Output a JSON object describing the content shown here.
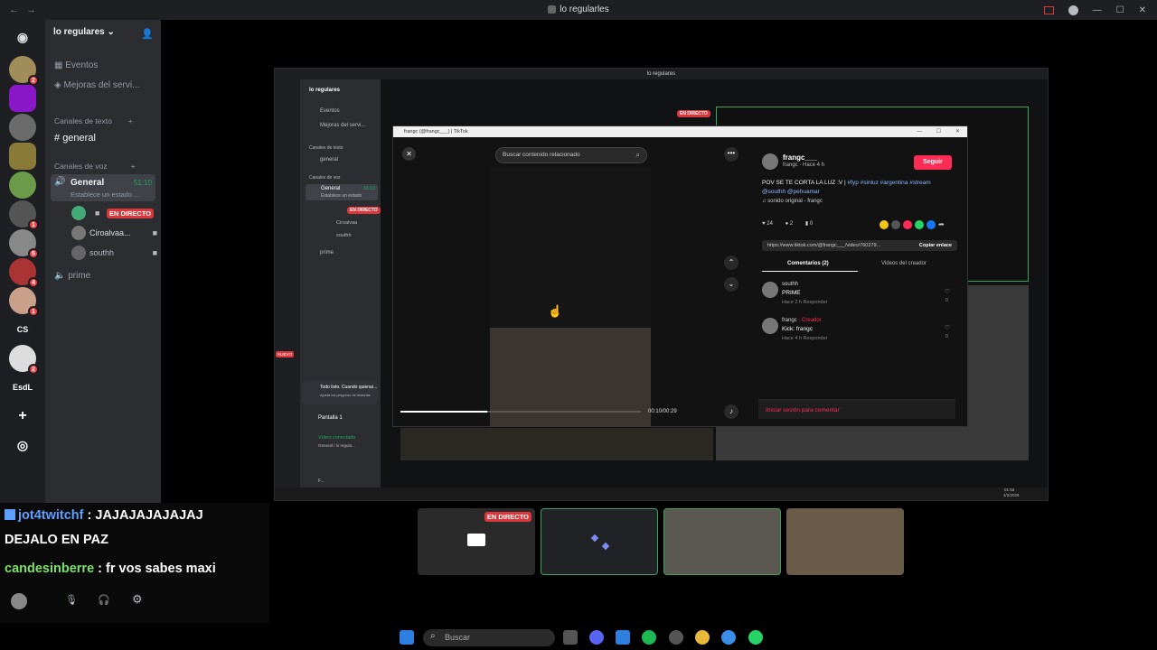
{
  "window": {
    "title": "lo regularles",
    "nav_back": "←",
    "nav_forward": "→"
  },
  "guilds": [
    {
      "badge": "2"
    },
    {
      "badge": ""
    },
    {
      "badge": ""
    },
    {
      "badge": ""
    },
    {
      "badge": ""
    },
    {
      "badge": "1"
    },
    {
      "badge": "5"
    },
    {
      "badge": "4"
    },
    {
      "badge": "1"
    },
    {
      "label": "CS"
    },
    {
      "badge": "2"
    },
    {
      "label": "EsdL"
    }
  ],
  "sidebar": {
    "server_name": "lo regulares",
    "events": "Eventos",
    "boost": "Mejoras del servi...",
    "text_category": "Canales de texto",
    "text_channel": "general",
    "voice_category": "Canales de voz",
    "voice_channel": "General",
    "voice_timer": "51:10",
    "voice_status": "Establece un estado ...",
    "members": [
      {
        "name": "",
        "live": "EN DIRECTO"
      },
      {
        "name": "Ciroalvaa..."
      },
      {
        "name": "southh"
      }
    ],
    "other_voice": "prime"
  },
  "inner": {
    "title": "lo regulares",
    "server_name": "lo regulares",
    "events": "Eventos",
    "boost": "Mejoras del servi...",
    "text_category": "Canales de texto",
    "text_channel": "general",
    "voice_category": "Canales de voz",
    "voice_channel": "General",
    "voice_timer": "51:10",
    "voice_status": "Establece un estado",
    "live": "EN DIRECTO",
    "member2": "Ciroalvaa",
    "member3": "southh",
    "other_voice": "prime",
    "new_badge": "NUEVO",
    "notice_title": "Todo listo. Cuando quieras...",
    "notice_sub": "Ajusta los progreso de historias",
    "screen": "Pantalla 1",
    "voice_connected": "Vídeo conectado",
    "voice_path": "General / lo regula...",
    "user": "F...",
    "live_top": "EN DIRECTO",
    "clock": "01:56",
    "date": "4/2/2026"
  },
  "tiktok": {
    "title": "frangc (@frangc___) | TikTok",
    "search_placeholder": "Buscar contenido relacionado",
    "time": "00:10/00:29",
    "user": "frangc___",
    "user_sub": "frangc · Hace 4 h",
    "follow": "Seguir",
    "caption": "POV SE TE CORTA LA LUZ :V |",
    "tags": "#fyp #sinluz #argentina #stream",
    "mentions": "@southh @pehuamar",
    "sound": "sonido original - frangc",
    "likes": "24",
    "comments_count": "2",
    "saves": "0",
    "link": "https://www.tiktok.com/@frangc___/video/760279...",
    "copy_link": "Copiar enlace",
    "tab_comments": "Comentarios (2)",
    "tab_videos": "Videos del creador",
    "comments": [
      {
        "user": "southh",
        "creator": "",
        "text": "PRIME",
        "time": "Hace 2 h",
        "reply": "Responder",
        "likes": "0"
      },
      {
        "user": "frangc",
        "creator": "· Creador",
        "text": "Kick: frangc",
        "time": "Hace 4 h",
        "reply": "Responder",
        "likes": "0"
      }
    ],
    "login_comment": "Iniciar sesión para comentar",
    "progress": 0.36
  },
  "stream_thumbs": {
    "live": "EN DIRECTO"
  },
  "chat": [
    {
      "user": "jot4twitchf",
      "text": " : JAJAJAJAJAJAJ"
    },
    {
      "user": "",
      "text": "DEJALO EN PAZ"
    },
    {
      "user": "candesinberre",
      "text": " : fr vos sabes maxi"
    }
  ],
  "taskbar": {
    "search": "Buscar"
  },
  "colors": {
    "accent": "#5865f2",
    "live": "#da373c",
    "tiktok": "#fe2c55",
    "online": "#23a55a",
    "chat_user1": "#5aa0ff",
    "chat_user2": "#7ee06a"
  }
}
